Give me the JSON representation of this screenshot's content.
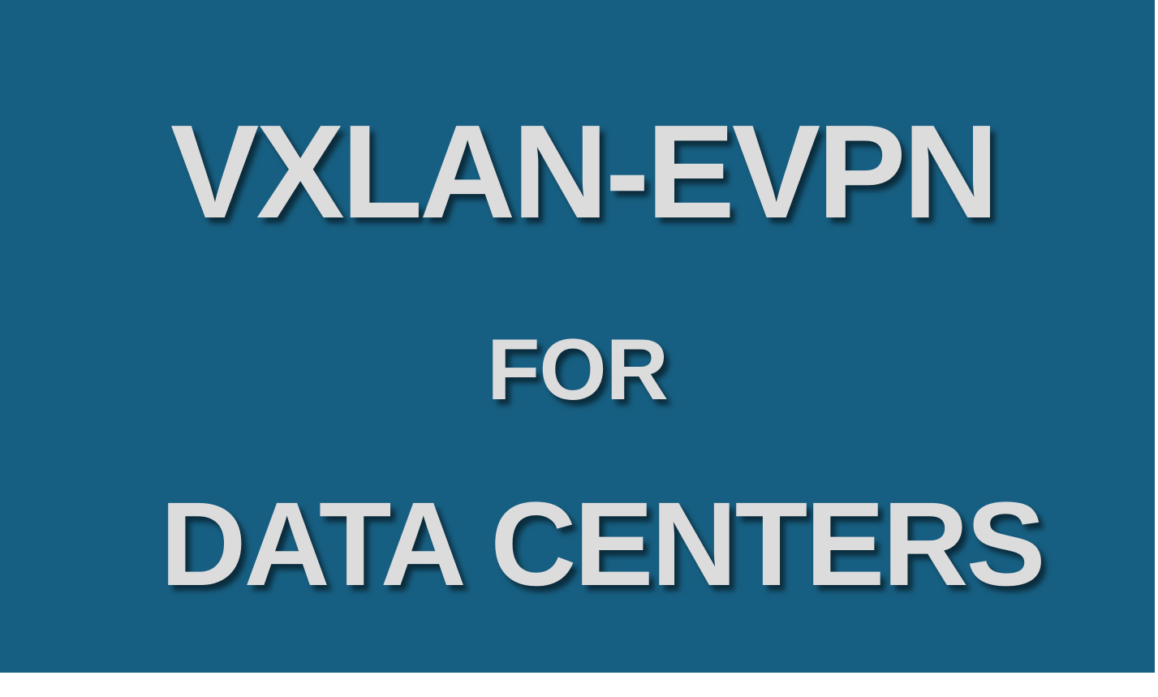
{
  "banner": {
    "background_color": "#175f82",
    "text_color": "#dcdcdc",
    "line1": "VXLAN-EVPN",
    "line2": "FOR",
    "line3": "DATA CENTERS"
  }
}
